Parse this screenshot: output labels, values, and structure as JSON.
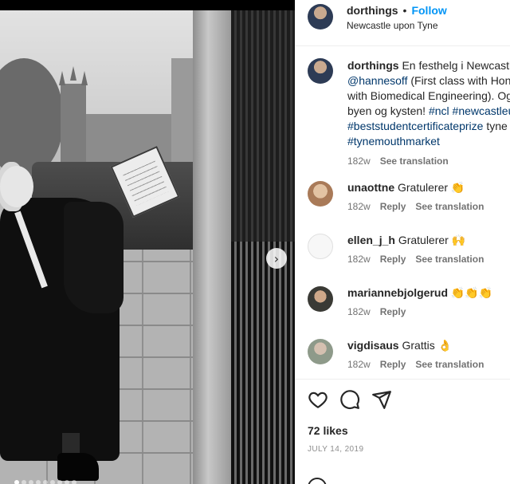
{
  "post": {
    "username": "dorthings",
    "follow_label": "Follow",
    "separator": "•",
    "location": "Newcastle upon Tyne",
    "carousel_total_dots": 9,
    "carousel_active_index": 0
  },
  "caption": {
    "username": "dorthings",
    "line1": "En festhelg i Newcastle",
    "mention": "@hannesoff",
    "line2": " (First class with Hono",
    "line3": "with Biomedical Engineering). Og",
    "line4a": "byen og kysten! ",
    "tag1": "#ncl",
    "tag2": "#newcastleu",
    "tag3": "#beststudentcertificateprize",
    "line5b": " tyne",
    "tag4": "#tynemouthmarket",
    "age": "182w",
    "see_translation": "See translation"
  },
  "comments": [
    {
      "username": "unaottne",
      "text": "Gratulerer",
      "emoji": "👏",
      "age": "182w",
      "reply": "Reply",
      "see_translation": "See translation"
    },
    {
      "username": "ellen_j_h",
      "text": "Gratulerer",
      "emoji": "🙌",
      "age": "182w",
      "reply": "Reply",
      "see_translation": "See translation"
    },
    {
      "username": "mariannebjolgerud",
      "text": "",
      "emoji": "👏👏👏",
      "age": "182w",
      "reply": "Reply",
      "see_translation": ""
    },
    {
      "username": "vigdisaus",
      "text": "Grattis",
      "emoji": "👌",
      "age": "182w",
      "reply": "Reply",
      "see_translation": "See translation"
    }
  ],
  "footer": {
    "likes": "72 likes",
    "date": "JULY 14, 2019"
  },
  "icons": {
    "like": "heart-icon",
    "comment": "comment-icon",
    "share": "share-icon",
    "next": "chevron-right-icon"
  }
}
